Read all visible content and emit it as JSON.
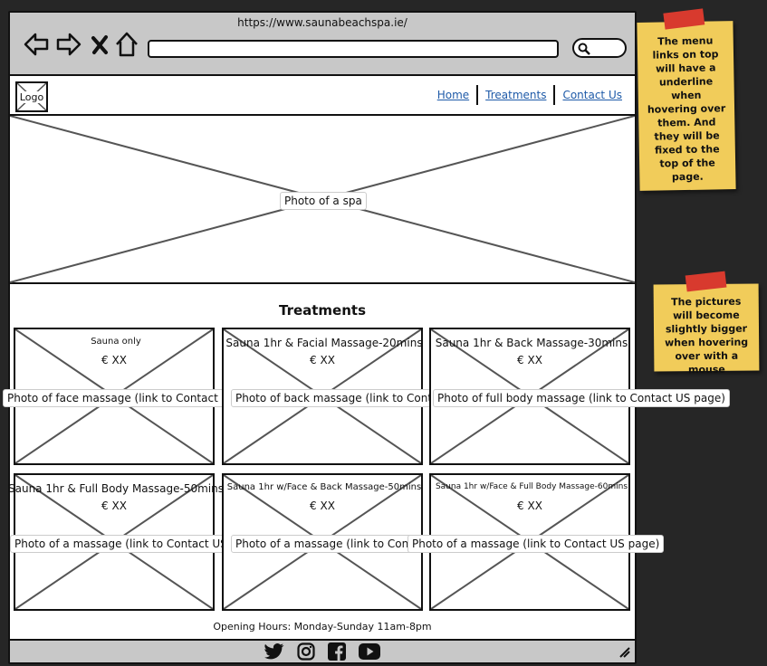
{
  "browser": {
    "url": "https://www.saunabeachspa.ie/"
  },
  "header": {
    "logo_label": "Logo",
    "menu": [
      {
        "label": "Home"
      },
      {
        "label": "Treatments"
      },
      {
        "label": "Contact Us"
      }
    ]
  },
  "hero": {
    "placeholder_label": "Photo of a spa"
  },
  "treatments": {
    "title": "Treatments",
    "cards": [
      {
        "title": "Sauna only",
        "price": "€ XX",
        "photo_label": "Photo of face massage (link to Contact US page)"
      },
      {
        "title": "Sauna 1hr & Facial Massage-20mins",
        "price": "€ XX",
        "photo_label": "Photo of back massage (link to Contact US page)"
      },
      {
        "title": "Sauna 1hr & Back Massage-30mins",
        "price": "€ XX",
        "photo_label": "Photo of full body massage (link to Contact US page)"
      },
      {
        "title": "Sauna 1hr & Full Body Massage-50mins",
        "price": "€ XX",
        "photo_label": "Photo of a massage (link to Contact US page)"
      },
      {
        "title": "Sauna 1hr w/Face & Back Massage-50mins",
        "price": "€ XX",
        "photo_label": "Photo of a massage (link to Contact US page)"
      },
      {
        "title": "Sauna 1hr w/Face & Full Body Massage-60mins",
        "price": "€ XX",
        "photo_label": "Photo of a massage (link to Contact US page)"
      }
    ]
  },
  "footer": {
    "opening_hours": "Opening Hours: Monday-Sunday 11am-8pm",
    "social_icons": [
      "twitter-icon",
      "instagram-icon",
      "facebook-icon",
      "youtube-icon"
    ]
  },
  "notes": [
    {
      "text": "The menu links on top will have a underline when hovering over them. And they will be fixed to the top of the page."
    },
    {
      "text": "The pictures will become slightly bigger when hovering over with a mouse"
    }
  ],
  "colors": {
    "background": "#262626",
    "chrome": "#c8c8c8",
    "link": "#1e5aa8",
    "sticky_note": "#f1cc5a",
    "tape": "#d83a2e"
  }
}
